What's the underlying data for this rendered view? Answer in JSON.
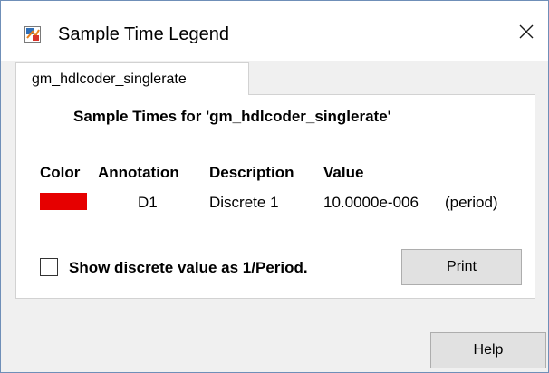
{
  "window": {
    "title": "Sample Time Legend",
    "close_glyph": "✕",
    "icon": "simulink-app-icon"
  },
  "tabs": [
    {
      "label": "gm_hdlcoder_singlerate",
      "selected": true
    }
  ],
  "panel": {
    "heading": "Sample Times for 'gm_hdlcoder_singlerate'",
    "columns": {
      "color": "Color",
      "annotation": "Annotation",
      "description": "Description",
      "value": "Value"
    },
    "rows": [
      {
        "color": "#e60000",
        "annotation": "D1",
        "description": "Discrete 1",
        "value": "10.0000e-006",
        "value_suffix": "(period)"
      }
    ],
    "checkbox": {
      "label": "Show discrete value as 1/Period.",
      "checked": false
    },
    "print_label": "Print"
  },
  "footer": {
    "help_label": "Help"
  },
  "colors": {
    "window_border": "#6f8fb8",
    "dialog_background": "#f0f0f0",
    "button_face": "#e1e1e1"
  }
}
